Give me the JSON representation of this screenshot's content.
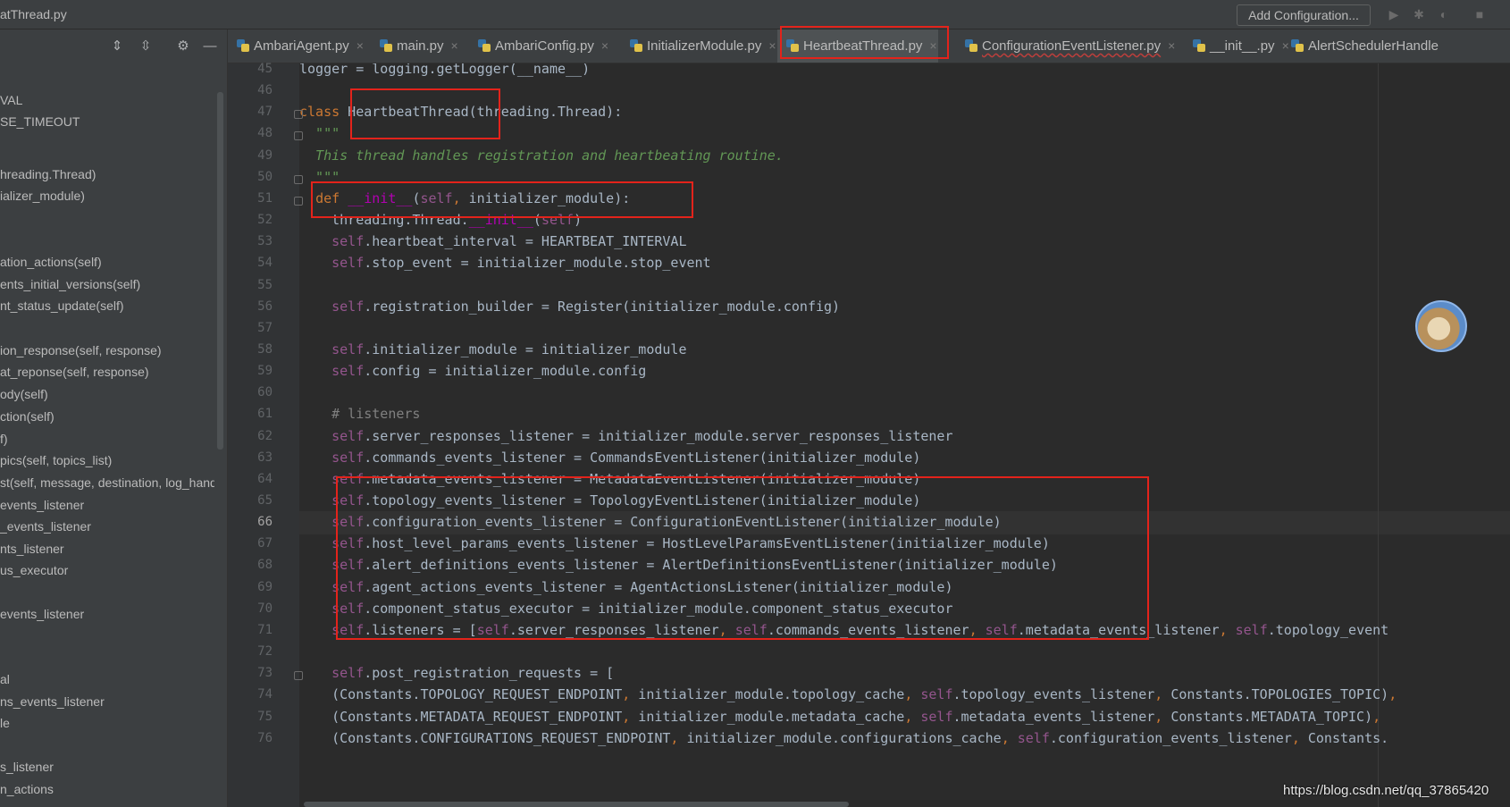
{
  "window": {
    "title": "atThread.py"
  },
  "toolbar": {
    "add_configuration_label": "Add Configuration..."
  },
  "structure": {
    "items": [
      "VAL",
      "SE_TIMEOUT",
      "hreading.Thread)",
      "ializer_module)",
      "ation_actions(self)",
      "ents_initial_versions(self)",
      "nt_status_update(self)",
      "ion_response(self, response)",
      "at_reponse(self, response)",
      "ody(self)",
      "ction(self)",
      "f)",
      "pics(self, topics_list)",
      "st(self, message, destination, log_hand",
      "events_listener",
      "_events_listener",
      "nts_listener",
      "us_executor",
      "events_listener",
      "al",
      "ns_events_listener",
      "le",
      "s_listener",
      "n_actions"
    ]
  },
  "tabs": [
    {
      "label": "AmbariAgent.py",
      "active": false,
      "error": false
    },
    {
      "label": "main.py",
      "active": false,
      "error": false
    },
    {
      "label": "AmbariConfig.py",
      "active": false,
      "error": false
    },
    {
      "label": "InitializerModule.py",
      "active": false,
      "error": false
    },
    {
      "label": "HeartbeatThread.py",
      "active": true,
      "error": false
    },
    {
      "label": "ConfigurationEventListener.py",
      "active": false,
      "error": true
    },
    {
      "label": "__init__.py",
      "active": false,
      "error": false
    },
    {
      "label": "AlertSchedulerHandle",
      "active": false,
      "error": false
    }
  ],
  "editor": {
    "current_line": 66,
    "lines": [
      {
        "n": 45,
        "text": "logger = logging.getLogger(__name__)"
      },
      {
        "n": 46,
        "text": ""
      },
      {
        "n": 47,
        "text": "class HeartbeatThread(threading.Thread):"
      },
      {
        "n": 48,
        "text": "  \"\"\""
      },
      {
        "n": 49,
        "text": "  This thread handles registration and heartbeating routine."
      },
      {
        "n": 50,
        "text": "  \"\"\""
      },
      {
        "n": 51,
        "text": "  def __init__(self, initializer_module):"
      },
      {
        "n": 52,
        "text": "    threading.Thread.__init__(self)"
      },
      {
        "n": 53,
        "text": "    self.heartbeat_interval = HEARTBEAT_INTERVAL"
      },
      {
        "n": 54,
        "text": "    self.stop_event = initializer_module.stop_event"
      },
      {
        "n": 55,
        "text": ""
      },
      {
        "n": 56,
        "text": "    self.registration_builder = Register(initializer_module.config)"
      },
      {
        "n": 57,
        "text": ""
      },
      {
        "n": 58,
        "text": "    self.initializer_module = initializer_module"
      },
      {
        "n": 59,
        "text": "    self.config = initializer_module.config"
      },
      {
        "n": 60,
        "text": ""
      },
      {
        "n": 61,
        "text": "    # listeners"
      },
      {
        "n": 62,
        "text": "    self.server_responses_listener = initializer_module.server_responses_listener"
      },
      {
        "n": 63,
        "text": "    self.commands_events_listener = CommandsEventListener(initializer_module)"
      },
      {
        "n": 64,
        "text": "    self.metadata_events_listener = MetadataEventListener(initializer_module)"
      },
      {
        "n": 65,
        "text": "    self.topology_events_listener = TopologyEventListener(initializer_module)"
      },
      {
        "n": 66,
        "text": "    self.configuration_events_listener = ConfigurationEventListener(initializer_module)"
      },
      {
        "n": 67,
        "text": "    self.host_level_params_events_listener = HostLevelParamsEventListener(initializer_module)"
      },
      {
        "n": 68,
        "text": "    self.alert_definitions_events_listener = AlertDefinitionsEventListener(initializer_module)"
      },
      {
        "n": 69,
        "text": "    self.agent_actions_events_listener = AgentActionsListener(initializer_module)"
      },
      {
        "n": 70,
        "text": "    self.component_status_executor = initializer_module.component_status_executor"
      },
      {
        "n": 71,
        "text": "    self.listeners = [self.server_responses_listener, self.commands_events_listener, self.metadata_events_listener, self.topology_event"
      },
      {
        "n": 72,
        "text": ""
      },
      {
        "n": 73,
        "text": "    self.post_registration_requests = ["
      },
      {
        "n": 74,
        "text": "    (Constants.TOPOLOGY_REQUEST_ENDPOINT, initializer_module.topology_cache, self.topology_events_listener, Constants.TOPOLOGIES_TOPIC),"
      },
      {
        "n": 75,
        "text": "    (Constants.METADATA_REQUEST_ENDPOINT, initializer_module.metadata_cache, self.metadata_events_listener, Constants.METADATA_TOPIC),"
      },
      {
        "n": 76,
        "text": "    (Constants.CONFIGURATIONS_REQUEST_ENDPOINT, initializer_module.configurations_cache, self.configuration_events_listener, Constants."
      }
    ]
  },
  "watermark": "https://blog.csdn.net/qq_37865420",
  "colors": {
    "annotation_box": "#e3231b",
    "keyword": "#cc7832",
    "self": "#94558d",
    "docstring": "#629755",
    "comment": "#808080",
    "magic_method": "#b200b2"
  }
}
